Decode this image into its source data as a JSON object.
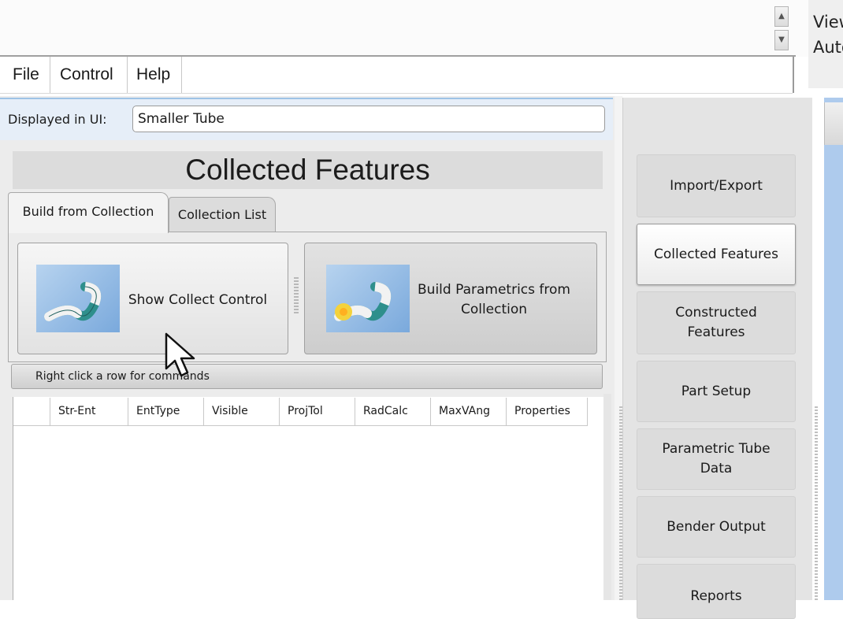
{
  "top_right": {
    "line1": "View",
    "line2": "Auto"
  },
  "menu": {
    "items": [
      "File",
      "Control",
      "Help"
    ]
  },
  "display": {
    "label": "Displayed in UI:",
    "value": "Smaller Tube"
  },
  "collected_features": {
    "title": "Collected Features",
    "tabs": [
      "Build from Collection",
      "Collection List"
    ],
    "buttons": {
      "show_collect_control": "Show Collect Control",
      "build_parametrics": "Build Parametrics from Collection"
    },
    "grid_hint": "Right click a row for commands",
    "columns": [
      "",
      "Str-Ent",
      "EntType",
      "Visible",
      "ProjTol",
      "RadCalc",
      "MaxVAng",
      "Properties"
    ]
  },
  "nav": {
    "items": [
      {
        "label": "Import/Export",
        "active": false
      },
      {
        "label": "Collected Features",
        "active": true
      },
      {
        "label": "Constructed Features",
        "active": false
      },
      {
        "label": "Part Setup",
        "active": false
      },
      {
        "label": "Parametric Tube Data",
        "active": false
      },
      {
        "label": "Bender Output",
        "active": false
      },
      {
        "label": "Reports",
        "active": false
      }
    ]
  },
  "colors": {
    "accent_blue": "#9ec3e6",
    "panel_gray": "#e4e4e4",
    "viewport_blue": "#aecbed"
  }
}
